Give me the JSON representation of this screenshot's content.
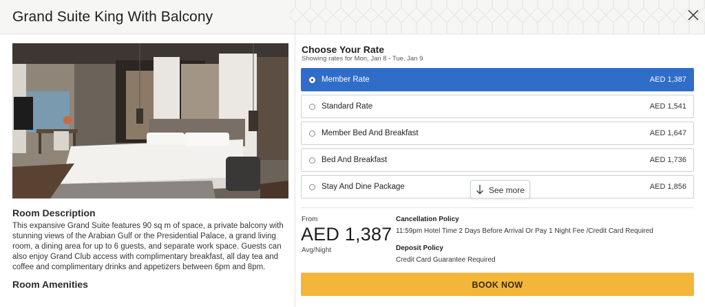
{
  "modal": {
    "title": "Grand Suite King With Balcony"
  },
  "room": {
    "description_heading": "Room Description",
    "description": "This expansive Grand Suite features 90 sq m of space, a private balcony with stunning views of the Arabian Gulf or the Presidential Palace, a grand living room, a dining area for up to 6 guests, and separate work space.  Guests can also enjoy Grand Club access with complimentary breakfast, all day tea and coffee and complimentary drinks and appetizers between 6pm and 8pm.",
    "amenities_heading": "Room Amenities"
  },
  "rates": {
    "heading": "Choose Your Rate",
    "subheading": "Showing rates for Mon, Jan 8 - Tue, Jan 9",
    "items": [
      {
        "name": "Member Rate",
        "price": "AED 1,387",
        "selected": true
      },
      {
        "name": "Standard Rate",
        "price": "AED 1,541",
        "selected": false
      },
      {
        "name": "Member Bed And Breakfast",
        "price": "AED 1,647",
        "selected": false
      },
      {
        "name": "Bed And Breakfast",
        "price": "AED 1,736",
        "selected": false
      },
      {
        "name": "Stay And Dine Package",
        "price": "AED 1,856",
        "selected": false
      }
    ],
    "see_more_label": "See more"
  },
  "summary": {
    "from_label": "From",
    "price": "AED 1,387",
    "per_label": "Avg/Night",
    "cancellation_heading": "Cancellation Policy",
    "cancellation_text": "11:59pm Hotel Time 2 Days Before Arrival Or Pay 1 Night Fee /Credit Card Required",
    "deposit_heading": "Deposit Policy",
    "deposit_text": "Credit Card Guarantee Required"
  },
  "actions": {
    "book_label": "BOOK NOW"
  },
  "colors": {
    "selected_rate": "#2f6dc8",
    "book_button": "#f3b63b",
    "header_bg": "#f6f6f4"
  },
  "icons": {
    "close": "close-icon",
    "see_more": "arrow-down-icon"
  }
}
